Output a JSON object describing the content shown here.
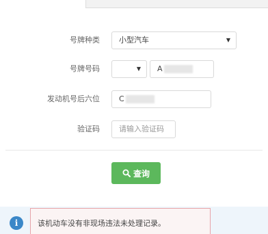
{
  "form": {
    "plate_type": {
      "label": "号牌种类",
      "value": "小型汽车"
    },
    "plate_number": {
      "label": "号牌号码",
      "prefix_value": "",
      "number_value": "A"
    },
    "engine_number": {
      "label": "发动机号后六位",
      "value": "C"
    },
    "captcha": {
      "label": "验证码",
      "placeholder": "请输入验证码"
    }
  },
  "search_button": {
    "label": "查询",
    "icon": "search-icon"
  },
  "notice": {
    "icon": "info-icon",
    "icon_glyph": "i",
    "text": "该机动车没有非现场违法未处理记录。"
  },
  "colors": {
    "button": "#5cb85c",
    "info_icon": "#3a87c8",
    "notice_border": "#e7a3a8"
  }
}
